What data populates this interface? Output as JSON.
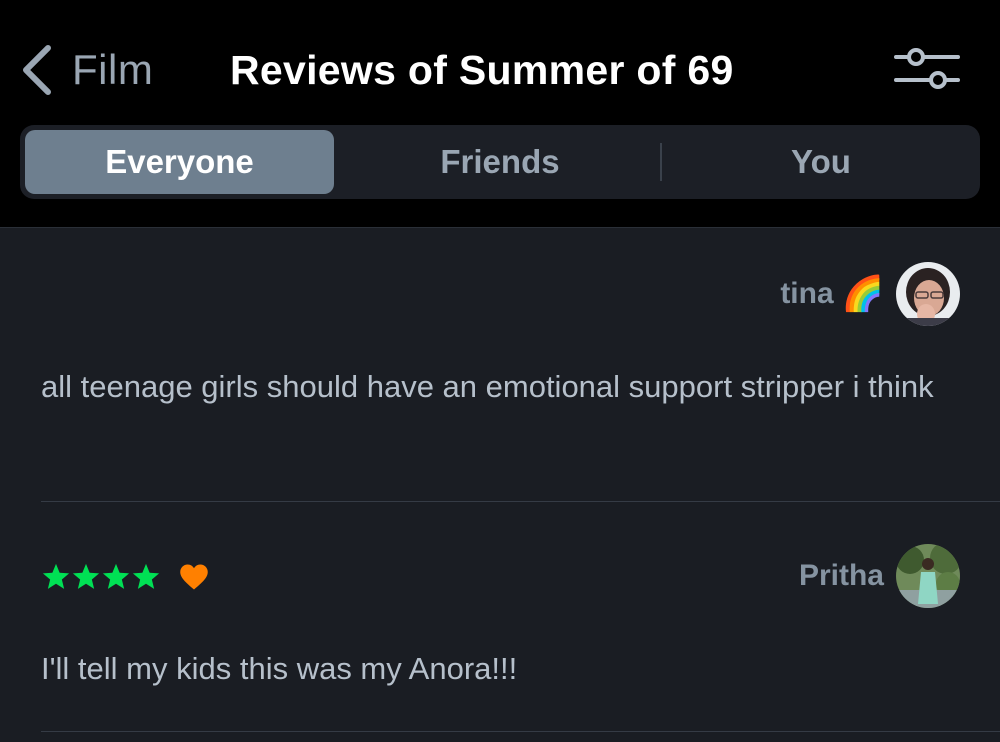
{
  "header": {
    "back_label": "Film",
    "title": "Reviews of Summer of 69",
    "filter_icon": "sliders-icon"
  },
  "tabs": [
    {
      "label": "Everyone",
      "active": true
    },
    {
      "label": "Friends",
      "active": false
    },
    {
      "label": "You",
      "active": false
    }
  ],
  "reviews": [
    {
      "username": "tina",
      "badge": "🌈",
      "text": "all teenage girls should have an emotional support stripper i think"
    },
    {
      "username": "Pritha",
      "rating": 4,
      "liked": true,
      "text": "I'll tell my kids this was my Anora!!!"
    }
  ],
  "colors": {
    "accent_star": "#00e054",
    "heart": "#ff8000",
    "active_tab": "#6e7f8f"
  }
}
